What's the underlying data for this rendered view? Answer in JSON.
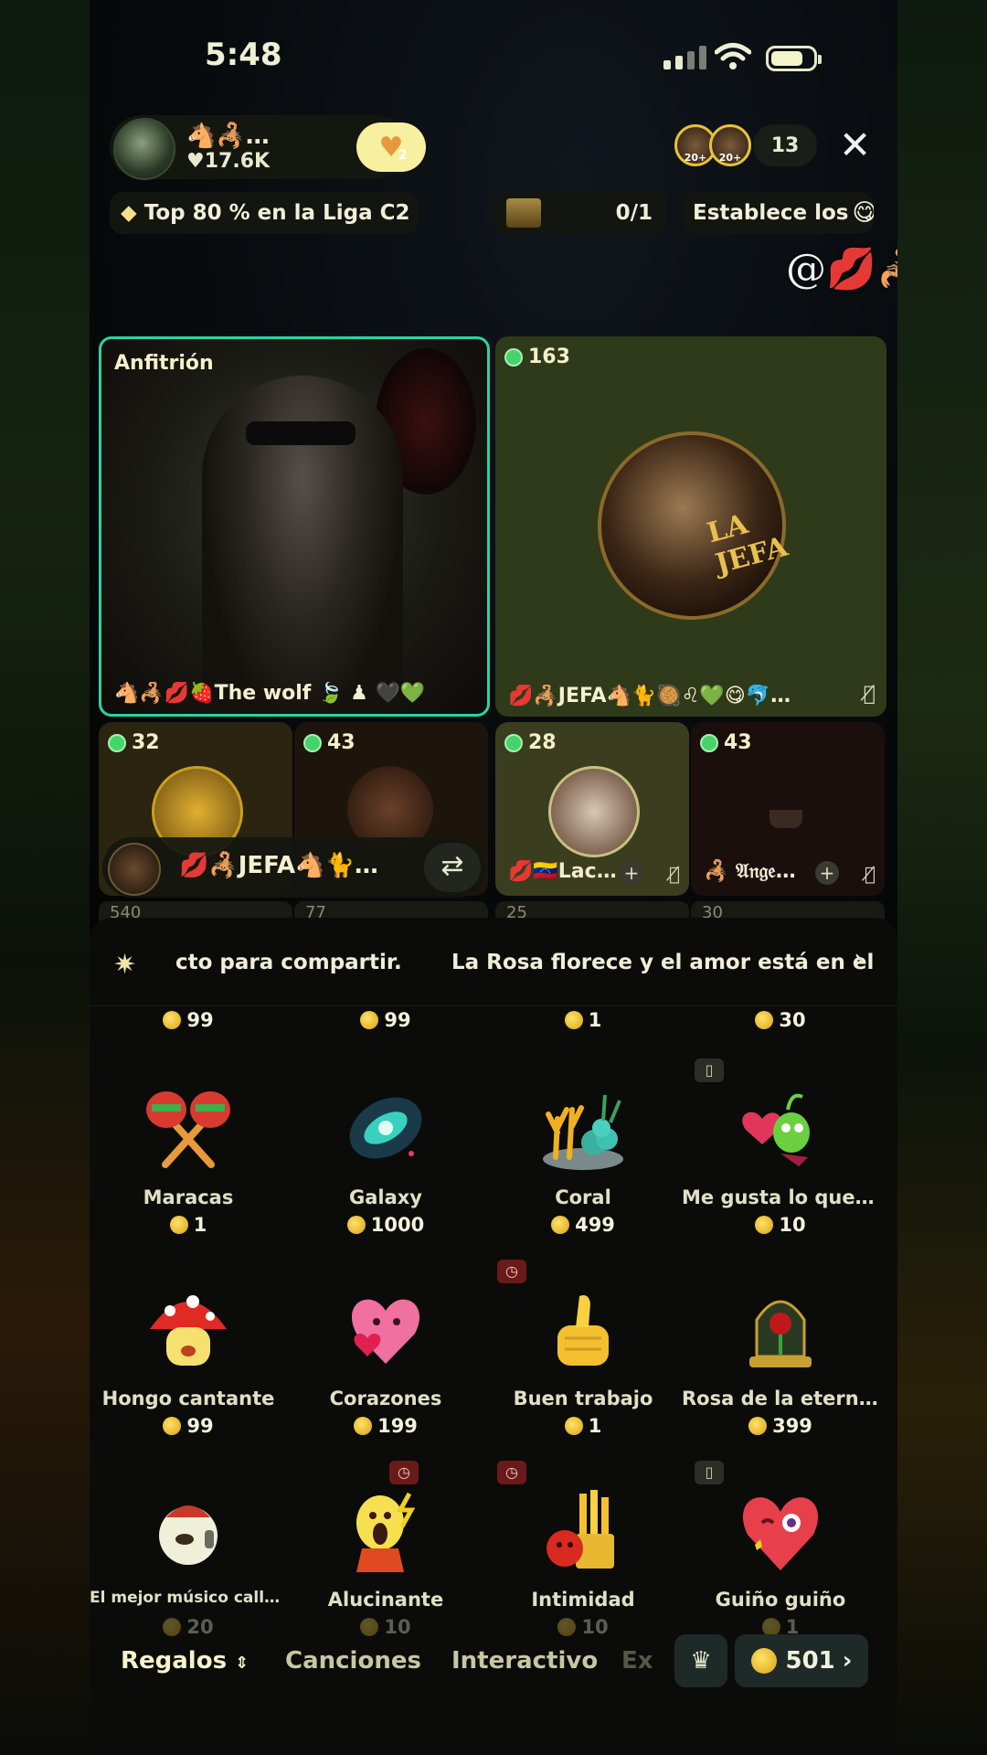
{
  "status": {
    "time": "5:48"
  },
  "host": {
    "name": "🐴🦂…",
    "likes": "♥17.6K",
    "heart_count": "2"
  },
  "viewers": {
    "badge1": "20+",
    "badge2": "20+",
    "count": "13"
  },
  "league": {
    "text": "Top 80 % en la Liga C2"
  },
  "trophy": {
    "progress": "0/1"
  },
  "goal": {
    "text": "Establece los"
  },
  "overlay_name": "@💋🦂JEFA🐺🐈",
  "host_tile": {
    "label": "Anfitrión",
    "name": "🐴🦂💋🍓The wolf 🍃 ♟ 🖤💚"
  },
  "guest_tile": {
    "count": "163",
    "name": "💋🦂JEFA🐴🐈🥘♌💚😋🐬…",
    "logo_text": "LA JEFA"
  },
  "small_tiles": [
    {
      "count": "32"
    },
    {
      "count": "43"
    },
    {
      "count": "28",
      "name": "💋🇻🇪Lac…"
    },
    {
      "count": "43",
      "name": "🦂 𝔄𝔫𝔤𝔢…"
    }
  ],
  "seat_bar": {
    "name": "💋🦂JEFA🐴🐈…",
    "swap": "⇄"
  },
  "peek_counts": [
    "540",
    "77",
    "25",
    "30"
  ],
  "ticker": {
    "text1": "cto para compartir.",
    "text2": "La Rosa florece y el amor está en el"
  },
  "top_prices": [
    "99",
    "99",
    "1",
    "30"
  ],
  "gifts": [
    {
      "name": "Maracas",
      "price": "1",
      "icon": "maracas"
    },
    {
      "name": "Galaxy",
      "price": "1000",
      "icon": "galaxy"
    },
    {
      "name": "Coral",
      "price": "499",
      "icon": "coral"
    },
    {
      "name": "Me gusta lo que veo",
      "price": "10",
      "icon": "heart-alien"
    },
    {
      "name": "Hongo cantante",
      "price": "99",
      "icon": "mushroom"
    },
    {
      "name": "Corazones",
      "price": "199",
      "icon": "hearts"
    },
    {
      "name": "Buen trabajo",
      "price": "1",
      "icon": "thumbs-up"
    },
    {
      "name": "Rosa de la eternidad",
      "price": "399",
      "icon": "rose-dome"
    },
    {
      "name": "El mejor músico calleje…",
      "price": "20",
      "icon": "sheep-musician"
    },
    {
      "name": "Alucinante",
      "price": "10",
      "icon": "scream"
    },
    {
      "name": "Intimidad",
      "price": "10",
      "icon": "fries"
    },
    {
      "name": "Guiño guiño",
      "price": "1",
      "icon": "wink-heart"
    }
  ],
  "tabs": {
    "regalos": "Regalos",
    "canciones": "Canciones",
    "interactivo": "Interactivo",
    "more": "Ex"
  },
  "balance": "501",
  "colors": {
    "accent_green": "#2ad3a2",
    "coin": "#f2c12e",
    "panel": "#0b0c0a"
  }
}
